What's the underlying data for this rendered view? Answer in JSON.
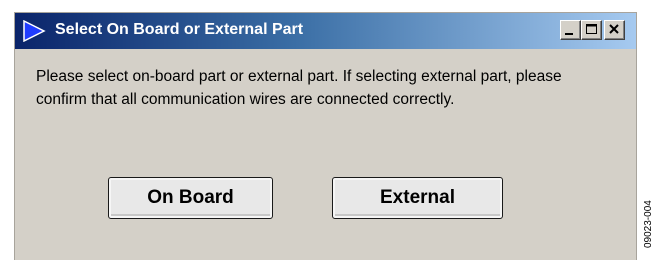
{
  "window": {
    "title": "Select On Board or External Part",
    "title_icon": "blue-triangle-icon",
    "controls": {
      "minimize_icon": "minimize-icon",
      "maximize_icon": "maximize-icon",
      "close_icon": "close-icon"
    }
  },
  "dialog": {
    "message": "Please select on-board part or external part. If selecting external part, please confirm that all communication wires are connected correctly.",
    "on_board_label": "On Board",
    "external_label": "External"
  },
  "figure_id": "09023-004",
  "colors": {
    "titlebar_start": "#0a246a",
    "titlebar_end": "#a6caf0",
    "window_bg": "#d4d0c8",
    "button_bg": "#e8e8e8"
  }
}
